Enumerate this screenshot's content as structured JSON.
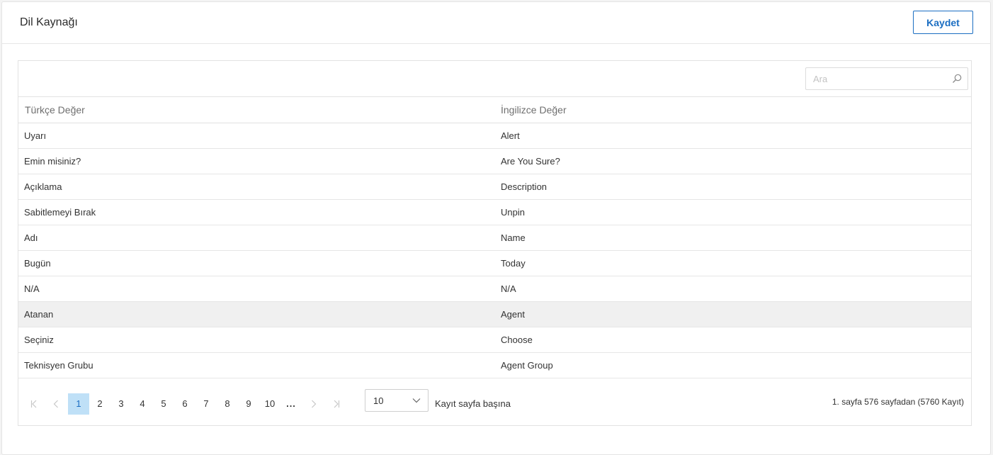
{
  "header": {
    "title": "Dil Kaynağı",
    "save_label": "Kaydet"
  },
  "search": {
    "placeholder": "Ara",
    "icon": "search-icon"
  },
  "table": {
    "columns": [
      "Türkçe Değer",
      "İngilizce Değer"
    ],
    "rows": [
      [
        "Uyarı",
        "Alert"
      ],
      [
        "Emin misiniz?",
        "Are You Sure?"
      ],
      [
        "Açıklama",
        "Description"
      ],
      [
        "Sabitlemeyi Bırak",
        "Unpin"
      ],
      [
        "Adı",
        "Name"
      ],
      [
        "Bugün",
        "Today"
      ],
      [
        "N/A",
        "N/A"
      ],
      [
        "Atanan",
        "Agent"
      ],
      [
        "Seçiniz",
        "Choose"
      ],
      [
        "Teknisyen Grubu",
        "Agent Group"
      ]
    ],
    "highlighted_row": 7
  },
  "pager": {
    "first": "K",
    "prev": "‹",
    "pages": [
      "1",
      "2",
      "3",
      "4",
      "5",
      "6",
      "7",
      "8",
      "9",
      "10"
    ],
    "current_page": "1",
    "ellipsis": "...",
    "next": "›",
    "last": "K",
    "page_size": "10",
    "page_size_label": "Kayıt sayfa başına",
    "info": "1. sayfa 576 sayfadan (5760 Kayıt)"
  },
  "colors": {
    "accent": "#1b6ec2",
    "active_page_bg": "#bfe0f7",
    "highlight_row_bg": "#f0f0f0"
  }
}
